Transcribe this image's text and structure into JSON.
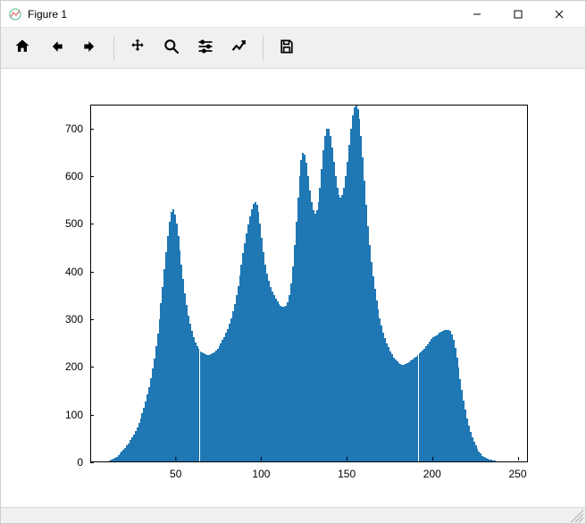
{
  "window": {
    "title": "Figure 1"
  },
  "toolbar": {
    "home": "Home",
    "back": "Back",
    "forward": "Forward",
    "pan": "Pan",
    "zoom": "Zoom",
    "subplots": "Configure subplots",
    "edit": "Edit axis",
    "save": "Save"
  },
  "chart_data": {
    "type": "bar",
    "title": "",
    "xlabel": "",
    "ylabel": "",
    "xlim": [
      0,
      256
    ],
    "ylim": [
      0,
      750
    ],
    "xticks": [
      50,
      100,
      150,
      200,
      250
    ],
    "yticks": [
      0,
      100,
      200,
      300,
      400,
      500,
      600,
      700
    ],
    "categories_note": "histogram over integer bins 0..255; values below are estimated bin counts",
    "values": [
      0,
      0,
      0,
      0,
      0,
      0,
      0,
      0,
      0,
      0,
      2,
      3,
      5,
      7,
      9,
      12,
      15,
      18,
      22,
      26,
      30,
      35,
      40,
      46,
      52,
      58,
      65,
      73,
      82,
      92,
      103,
      115,
      128,
      142,
      158,
      176,
      196,
      218,
      243,
      270,
      300,
      333,
      368,
      405,
      440,
      475,
      505,
      525,
      530,
      520,
      500,
      475,
      445,
      415,
      385,
      355,
      330,
      308,
      290,
      275,
      262,
      252,
      244,
      238,
      233,
      230,
      228,
      226,
      225,
      225,
      226,
      228,
      231,
      235,
      239,
      244,
      250,
      256,
      263,
      271,
      280,
      290,
      302,
      316,
      332,
      350,
      370,
      392,
      415,
      438,
      460,
      480,
      498,
      515,
      530,
      542,
      545,
      540,
      525,
      500,
      470,
      440,
      415,
      395,
      380,
      368,
      358,
      350,
      343,
      337,
      332,
      328,
      326,
      326,
      328,
      335,
      350,
      375,
      410,
      455,
      505,
      555,
      600,
      633,
      648,
      645,
      628,
      600,
      570,
      545,
      528,
      522,
      528,
      545,
      575,
      615,
      655,
      685,
      700,
      700,
      685,
      660,
      630,
      600,
      575,
      560,
      555,
      560,
      575,
      600,
      630,
      665,
      700,
      728,
      745,
      750,
      740,
      720,
      685,
      640,
      590,
      540,
      495,
      455,
      420,
      390,
      363,
      340,
      320,
      302,
      286,
      272,
      260,
      250,
      241,
      233,
      226,
      220,
      215,
      211,
      208,
      206,
      205,
      205,
      206,
      208,
      210,
      213,
      216,
      219,
      222,
      225,
      228,
      231,
      234,
      238,
      243,
      248,
      253,
      258,
      262,
      265,
      267,
      269,
      271,
      273,
      275,
      277,
      278,
      278,
      275,
      268,
      256,
      240,
      220,
      198,
      175,
      152,
      130,
      110,
      92,
      77,
      64,
      53,
      44,
      36,
      29,
      23,
      18,
      14,
      11,
      9,
      7,
      6,
      5,
      4,
      3,
      2,
      2,
      1,
      1,
      1,
      0,
      0,
      0,
      0,
      0,
      0,
      0,
      0,
      0,
      0,
      0,
      0,
      0,
      0
    ],
    "color": "#1f77b4"
  }
}
